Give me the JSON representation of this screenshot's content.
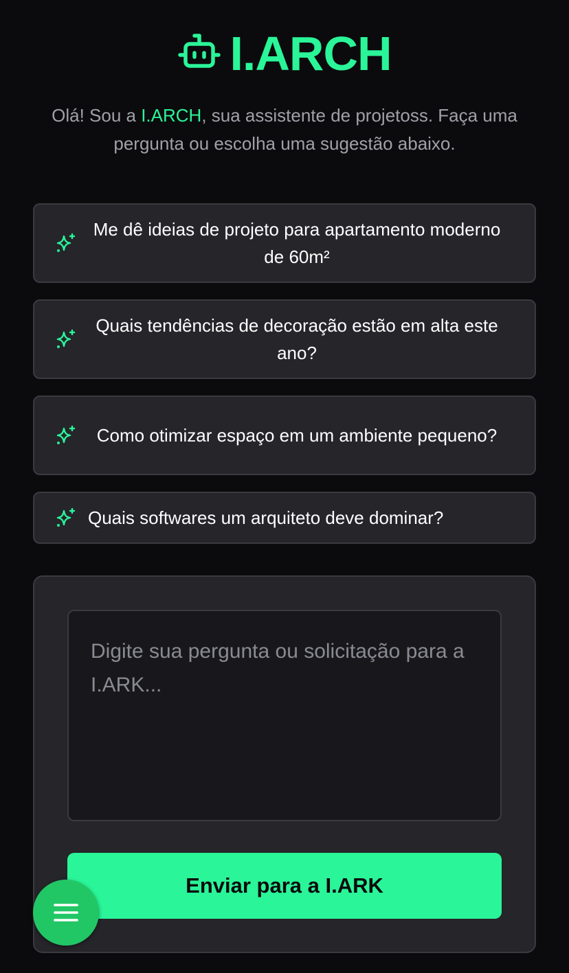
{
  "header": {
    "logo_icon": "robot-icon",
    "brand": "I.ARCH",
    "accent_color": "#2af598"
  },
  "intro": {
    "prefix": "Olá! Sou a ",
    "highlight": "I.ARCH",
    "suffix": ", sua assistente de projetoss. Faça uma pergunta ou escolha uma sugestão abaixo."
  },
  "suggestions": [
    {
      "icon": "sparkle-icon",
      "label": "Me dê ideias de projeto para apartamento moderno de 60m²"
    },
    {
      "icon": "sparkle-icon",
      "label": "Quais tendências de decoração estão em alta este ano?"
    },
    {
      "icon": "sparkle-icon",
      "label": "Como otimizar espaço em um ambiente pequeno?"
    },
    {
      "icon": "sparkle-icon",
      "label": "Quais softwares um arquiteto deve dominar?"
    }
  ],
  "composer": {
    "value": "",
    "placeholder": "Digite sua pergunta ou solicitação para a I.ARK...",
    "send_label": "Enviar para a I.ARK"
  },
  "fab": {
    "icon": "menu-icon"
  }
}
